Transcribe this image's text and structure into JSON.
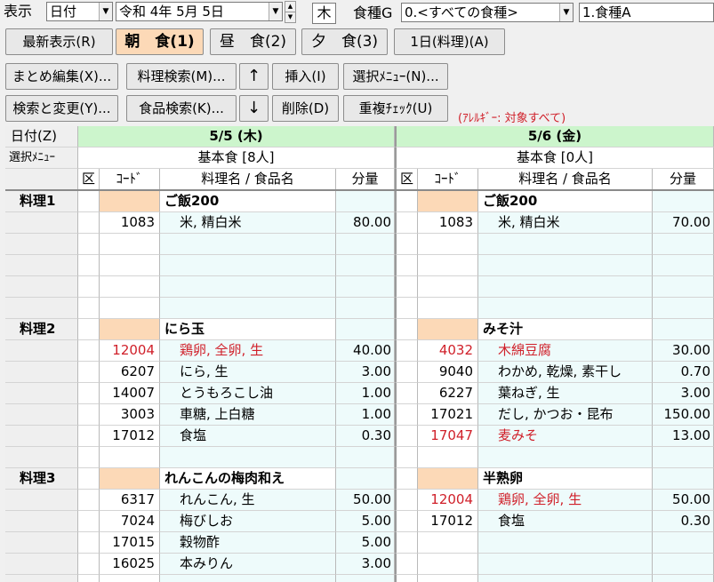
{
  "toolbar": {
    "display_label": "表示",
    "display_mode": "日付",
    "date_value": "令和 4年 5月 5日",
    "weekday": "木",
    "food_group_label": "食種G",
    "food_group_value": "0.<すべての食種>",
    "food_type_value": "1.食種A"
  },
  "meal_buttons": {
    "latest": "最新表示(R)",
    "breakfast": "朝　食(1)",
    "lunch": "昼　食(2)",
    "dinner": "夕　食(3)",
    "day_recipe": "1日(料理)(A)"
  },
  "edit_buttons": {
    "batch_edit": "まとめ編集(X)...",
    "recipe_search": "料理検索(M)...",
    "up_arrow": "↑",
    "insert": "挿入(I)",
    "select_menu": "選択ﾒﾆｭｰ(N)...",
    "search_replace": "検索と変更(Y)...",
    "food_search": "食品検索(K)...",
    "down_arrow": "↓",
    "delete": "削除(D)",
    "duplicate_check": "重複ﾁｪｯｸ(U)"
  },
  "allergy_note": "(ｱﾚﾙｷﾞｰ: 対象すべて)",
  "grid": {
    "date_label": "日付(Z)",
    "menu_label": "選択ﾒﾆｭｰ",
    "col_ku": "区",
    "col_code": "ｺｰﾄﾞ",
    "col_name": "料理名 / 食品名",
    "col_qty": "分量",
    "days": [
      {
        "date": "5/5 (木)",
        "menu": "基本食 [8人]"
      },
      {
        "date": "5/6 (金)",
        "menu": "基本食 [0人]"
      }
    ],
    "rows": [
      {
        "label": "料理1",
        "left": {
          "name": "ご飯200",
          "dish": true
        },
        "right": {
          "name": "ご飯200",
          "dish": true
        }
      },
      {
        "label": "",
        "left": {
          "code": "1083",
          "name": "米, 精白米",
          "qty": "80.00"
        },
        "right": {
          "code": "1083",
          "name": "米, 精白米",
          "qty": "70.00"
        }
      },
      {
        "label": "",
        "left": {},
        "right": {}
      },
      {
        "label": "",
        "left": {},
        "right": {}
      },
      {
        "label": "",
        "left": {},
        "right": {}
      },
      {
        "label": "",
        "left": {},
        "right": {}
      },
      {
        "label": "料理2",
        "left": {
          "name": "にら玉",
          "dish": true
        },
        "right": {
          "name": "みそ汁",
          "dish": true
        }
      },
      {
        "label": "",
        "left": {
          "code": "12004",
          "name": "鶏卵, 全卵, 生",
          "qty": "40.00",
          "red": true
        },
        "right": {
          "code": "4032",
          "name": "木綿豆腐",
          "qty": "30.00",
          "red": true
        }
      },
      {
        "label": "",
        "left": {
          "code": "6207",
          "name": "にら, 生",
          "qty": "3.00"
        },
        "right": {
          "code": "9040",
          "name": "わかめ, 乾燥, 素干し",
          "qty": "0.70"
        }
      },
      {
        "label": "",
        "left": {
          "code": "14007",
          "name": "とうもろこし油",
          "qty": "1.00"
        },
        "right": {
          "code": "6227",
          "name": "葉ねぎ, 生",
          "qty": "3.00"
        }
      },
      {
        "label": "",
        "left": {
          "code": "3003",
          "name": "車糖, 上白糖",
          "qty": "1.00"
        },
        "right": {
          "code": "17021",
          "name": "だし, かつお・昆布",
          "qty": "150.00"
        }
      },
      {
        "label": "",
        "left": {
          "code": "17012",
          "name": "食塩",
          "qty": "0.30"
        },
        "right": {
          "code": "17047",
          "name": "麦みそ",
          "qty": "13.00",
          "red": true
        }
      },
      {
        "label": "",
        "left": {},
        "right": {}
      },
      {
        "label": "料理3",
        "left": {
          "name": "れんこんの梅肉和え",
          "dish": true
        },
        "right": {
          "name": "半熟卵",
          "dish": true
        }
      },
      {
        "label": "",
        "left": {
          "code": "6317",
          "name": "れんこん, 生",
          "qty": "50.00"
        },
        "right": {
          "code": "12004",
          "name": "鶏卵, 全卵, 生",
          "qty": "50.00",
          "red": true
        }
      },
      {
        "label": "",
        "left": {
          "code": "7024",
          "name": "梅びしお",
          "qty": "5.00"
        },
        "right": {
          "code": "17012",
          "name": "食塩",
          "qty": "0.30"
        }
      },
      {
        "label": "",
        "left": {
          "code": "17015",
          "name": "穀物酢",
          "qty": "5.00"
        },
        "right": {}
      },
      {
        "label": "",
        "left": {
          "code": "16025",
          "name": "本みりん",
          "qty": "3.00"
        },
        "right": {}
      },
      {
        "label": "",
        "left": {},
        "right": {}
      }
    ]
  },
  "colors": {
    "header_green": "#ccf5cc",
    "code_cell_peach": "#fcd9b7",
    "light_cyan": "#eefbfb",
    "label_gray": "#efefef",
    "allergy_red": "#d0202a"
  }
}
